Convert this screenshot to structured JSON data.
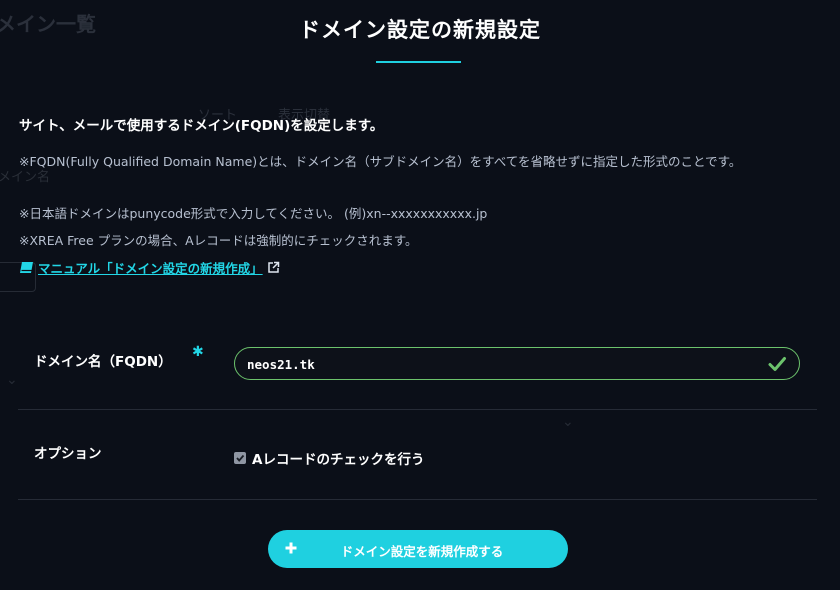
{
  "background": {
    "title": "メイン一覧",
    "tabs": [
      "ソート",
      "表示切替"
    ],
    "left_label": "メイン名"
  },
  "modal": {
    "title": "ドメイン設定の新規設定",
    "lead": "サイト、メールで使用するドメイン(FQDN)を設定します。",
    "notes": [
      "※FQDN(Fully Qualified Domain Name)とは、ドメイン名（サブドメイン名）をすべてを省略せずに指定した形式のことです。",
      "※日本語ドメインはpunycode形式で入力してください。 (例)xn--xxxxxxxxxxx.jp",
      "※XREA Free プランの場合、Aレコードは強制的にチェックされます。"
    ],
    "manual_link": "マニュアル「ドメイン設定の新規作成」",
    "fields": {
      "fqdn_label": "ドメイン名（FQDN）",
      "required_mark": "✱",
      "fqdn_value": "neos21.tk",
      "option_label": "オプション",
      "option_checkbox_label": "Aレコードのチェックを行う"
    },
    "submit_label": "ドメイン設定を新規作成する"
  },
  "colors": {
    "accent": "#1fd0e0",
    "valid": "#6cc36c",
    "background": "#0b0f18"
  },
  "icons": {
    "book": "book-icon",
    "external": "external-link-icon",
    "valid": "check-icon",
    "plus": "plus-icon"
  }
}
